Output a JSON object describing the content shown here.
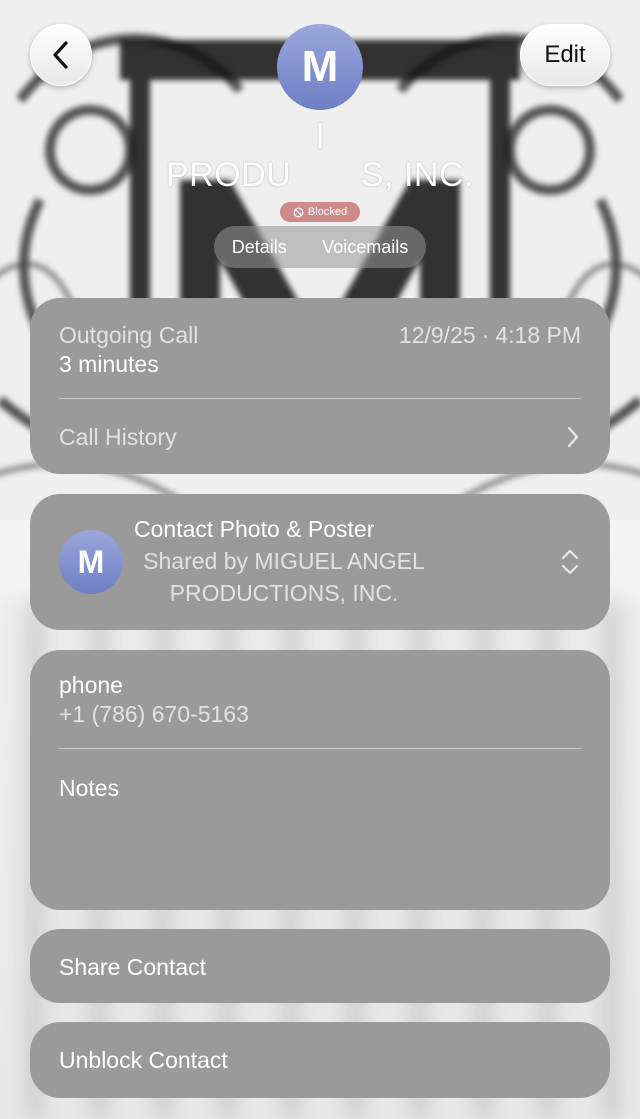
{
  "nav": {
    "back_icon": "chevron-left-icon",
    "edit_label": "Edit"
  },
  "contact": {
    "avatar_initial": "M",
    "name_line1": "l",
    "name_line2": "PRODU       S, INC."
  },
  "badge": {
    "blocked_icon": "blocked-icon",
    "blocked_label": "Blocked"
  },
  "tabs": [
    {
      "label": "Details"
    },
    {
      "label": "Voicemails"
    }
  ],
  "recent_call": {
    "type": "Outgoing Call",
    "duration": "3 minutes",
    "date": "12/9/25",
    "time": "4:18 PM",
    "history_label": "Call History",
    "history_icon": "chevron-right-icon"
  },
  "photo_poster": {
    "avatar_initial": "M",
    "title": "Contact Photo & Poster",
    "shared_line1": "Shared by MIGUEL ANGEL",
    "shared_line2": "PRODUCTIONS, INC.",
    "expand_icon": "chevron-up-down-icon"
  },
  "phone": {
    "label": "phone",
    "number": "+1 (786) 670-5163"
  },
  "notes": {
    "label": "Notes"
  },
  "actions": {
    "share_label": "Share Contact",
    "unblock_label": "Unblock Contact"
  },
  "colors": {
    "card_bg": "#9a9a9a",
    "blocked_badge": "#cf8a8a",
    "avatar_gradient_top": "#9aa7dc",
    "avatar_gradient_bottom": "#6f7ec4"
  }
}
